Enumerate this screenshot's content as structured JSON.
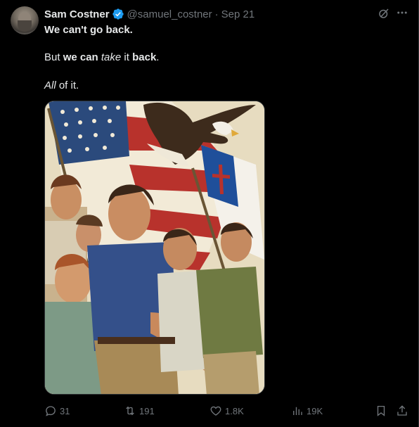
{
  "post": {
    "author_name": "Sam Costner",
    "handle": "@samuel_costner",
    "separator": "·",
    "date": "Sep 21",
    "line1": {
      "a": "We can't go back."
    },
    "line2": {
      "a": "But ",
      "b": "we can ",
      "c": "take",
      "d": " it ",
      "e": "back",
      "f": "."
    },
    "line3": {
      "a": "All",
      "b": " of it."
    }
  },
  "icons": {
    "verified": "verified-badge-icon",
    "grok": "grok-icon",
    "more": "more-icon",
    "reply": "reply-icon",
    "retweet": "retweet-icon",
    "like": "heart-icon",
    "views": "views-icon",
    "bookmark": "bookmark-icon",
    "share": "share-icon"
  },
  "actions": {
    "replies": "31",
    "reposts": "191",
    "likes": "1.8K",
    "views": "19K"
  },
  "colors": {
    "background": "#000000",
    "text": "#e7e9ea",
    "muted": "#71767b",
    "verified_blue": "#1d9bf0",
    "border": "#2f3336"
  }
}
